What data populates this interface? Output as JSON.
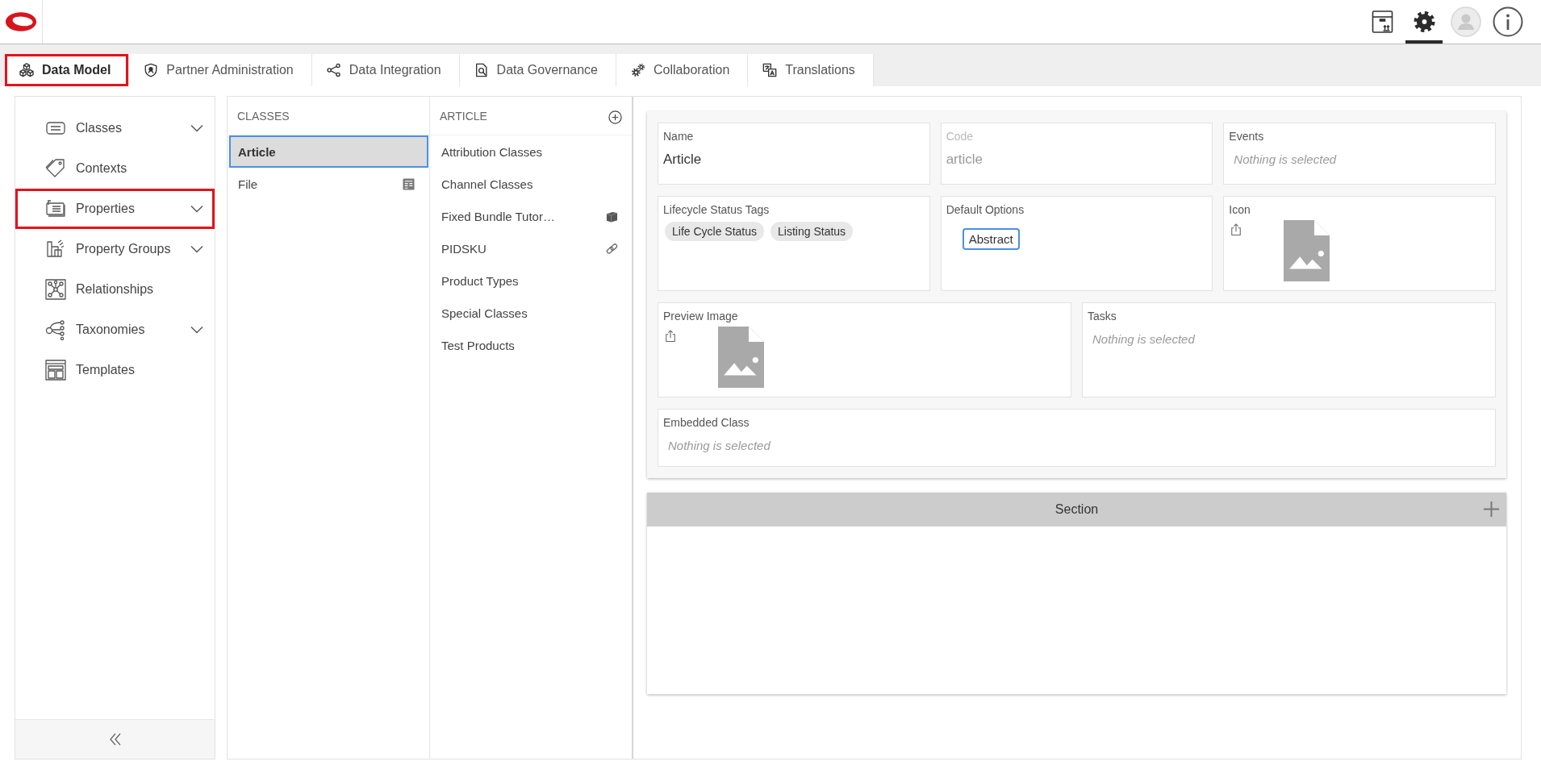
{
  "header": {
    "toolbar": [
      {
        "selected": false
      },
      {
        "selected": true
      },
      {
        "selected": false
      },
      {
        "selected": false
      }
    ]
  },
  "tabs": [
    {
      "label": "Data Model",
      "selected": true,
      "highlighted": true
    },
    {
      "label": "Partner Administration",
      "selected": false,
      "highlighted": false
    },
    {
      "label": "Data Integration",
      "selected": false,
      "highlighted": false
    },
    {
      "label": "Data Governance",
      "selected": false,
      "highlighted": false
    },
    {
      "label": "Collaboration",
      "selected": false,
      "highlighted": false
    },
    {
      "label": "Translations",
      "selected": false,
      "highlighted": false
    }
  ],
  "sidebar": {
    "items": [
      {
        "label": "Classes",
        "expandable": true,
        "highlighted": false
      },
      {
        "label": "Contexts",
        "expandable": false,
        "highlighted": false
      },
      {
        "label": "Properties",
        "expandable": true,
        "highlighted": true
      },
      {
        "label": "Property Groups",
        "expandable": true,
        "highlighted": false
      },
      {
        "label": "Relationships",
        "expandable": false,
        "highlighted": false
      },
      {
        "label": "Taxonomies",
        "expandable": true,
        "highlighted": false
      },
      {
        "label": "Templates",
        "expandable": false,
        "highlighted": false
      }
    ]
  },
  "classes_column": {
    "header": "CLASSES",
    "items": [
      {
        "label": "Article",
        "kind": "plain",
        "selected": true
      },
      {
        "label": "File",
        "kind": "file",
        "selected": false
      }
    ]
  },
  "article_column": {
    "header": "ARTICLE",
    "items": [
      {
        "label": "Attribution Classes",
        "kind": "plain"
      },
      {
        "label": "Channel Classes",
        "kind": "plain"
      },
      {
        "label": "Fixed Bundle Tutor…",
        "kind": "bundle"
      },
      {
        "label": "PIDSKU",
        "kind": "linked"
      },
      {
        "label": "Product Types",
        "kind": "plain"
      },
      {
        "label": "Special Classes",
        "kind": "plain"
      },
      {
        "label": "Test Products",
        "kind": "plain"
      }
    ]
  },
  "form": {
    "rows": [
      {
        "fields": [
          {
            "kind": "text",
            "label": "Name",
            "value": "Article",
            "disabled": false
          },
          {
            "kind": "text",
            "label": "Code",
            "value": "article",
            "disabled": true
          },
          {
            "kind": "select",
            "label": "Events",
            "placeholder": "Nothing is selected"
          }
        ]
      },
      {
        "fields": [
          {
            "kind": "tags",
            "label": "Lifecycle Status Tags",
            "tags": [
              "Life Cycle Status",
              "Listing Status"
            ]
          },
          {
            "kind": "options",
            "label": "Default Options",
            "options": [
              {
                "label": "Abstract",
                "selected": true
              }
            ]
          },
          {
            "kind": "image",
            "label": "Icon"
          }
        ]
      },
      {
        "fields": [
          {
            "kind": "image",
            "label": "Preview Image"
          },
          {
            "kind": "select",
            "label": "Tasks",
            "placeholder": "Nothing is selected"
          }
        ]
      },
      {
        "fields": [
          {
            "kind": "select",
            "label": "Embedded Class",
            "placeholder": "Nothing is selected"
          }
        ]
      }
    ]
  },
  "section": {
    "title": "Section"
  }
}
